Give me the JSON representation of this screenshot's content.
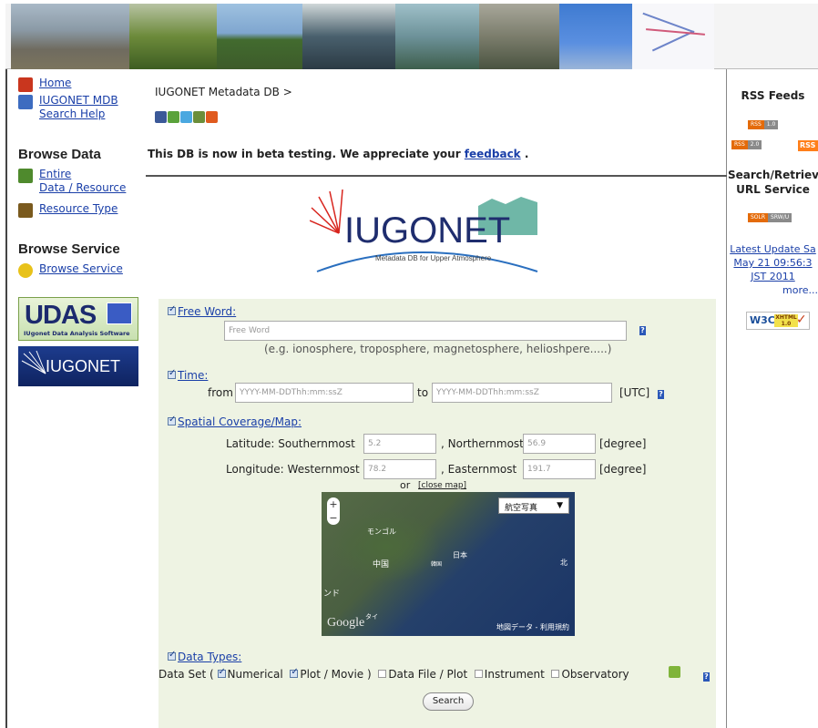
{
  "sidebar": {
    "links": [
      {
        "label": "Home",
        "icon": "home-icon"
      },
      {
        "label": "IUGONET MDB\nSearch Help",
        "icon": "magnifier-icon"
      }
    ],
    "browse_data": {
      "heading": "Browse Data",
      "items": [
        {
          "label": "Entire\nData / Resource",
          "icon": "database-icon"
        },
        {
          "label": "Resource Type",
          "icon": "filter-icon"
        }
      ]
    },
    "browse_service": {
      "heading": "Browse Service",
      "items": [
        {
          "label": "Browse Service",
          "icon": "globe-icon"
        }
      ]
    },
    "udas_logo": {
      "big": "UDAS",
      "small": "IUgonet Data Analysis Software"
    },
    "iugonet_logo": {
      "text": "IUGONET"
    }
  },
  "main": {
    "breadcrumb": "IUGONET Metadata DB >",
    "beta_notice": "This DB is now in beta testing. We appreciate your",
    "beta_link": "feedback",
    "beta_tail": ".",
    "logo": {
      "title": "IUGONET",
      "subtitle": "Metadata DB for Upper Atmosphere"
    }
  },
  "form": {
    "free_word": {
      "label": "Free Word:",
      "placeholder": "Free Word",
      "hint": "(e.g. ionosphere, troposphere, magnetosphere, helioshpere.....)"
    },
    "time": {
      "label": "Time:",
      "from_label": "from",
      "from_placeholder": "YYYY-MM-DDThh:mm:ssZ",
      "to_label": "to",
      "to_placeholder": "YYYY-MM-DDThh:mm:ssZ",
      "unit": "[UTC]"
    },
    "spatial": {
      "label": "Spatial Coverage/Map:",
      "lat_label": "Latitude:  Southernmost",
      "south": "5.2",
      "north_label": ", Northernmost",
      "north": "56.9",
      "lat_unit": "[degree]",
      "lon_label": "Longitude: Westernmost",
      "west": "78.2",
      "east_label": ", Easternmost",
      "east": "191.7",
      "lon_unit": "[degree]",
      "or": "or",
      "close_map": "[close map]"
    },
    "map": {
      "type_label": "航空写真",
      "label_mongolia": "モンゴル",
      "label_china": "中国",
      "label_korea": "韓国",
      "label_japan": "日本",
      "label_north": "北",
      "label_india": "ンド",
      "label_thai": "タイ",
      "google": "Google",
      "terms": "地図データ - 利用規約"
    },
    "data_types": {
      "label": "Data Types:",
      "dataset_open": "Data Set (",
      "numerical": "Numerical",
      "plot_movie": "Plot / Movie )",
      "data_file_plot": "Data File / Plot",
      "instrument": "Instrument",
      "observatory": "Observatory"
    },
    "search_label": "Search"
  },
  "right": {
    "rss_heading": "RSS Feeds",
    "rss_badge1_l": "RSS",
    "rss_badge1_r": "1.0",
    "rss_badge2_l": "RSS",
    "rss_badge2_r": "2.0",
    "rss_orange": "RSS",
    "search_heading": "Search/Retriev\nURL Service",
    "srw_badge_l": "SOLR",
    "srw_badge_r": "SRW/U",
    "latest": "Latest Update Sa\nMay 21 09:56:3\nJST 2011",
    "more": "more...",
    "w3c_w": "W3C",
    "w3c_x": "XHTML\n1.0"
  }
}
